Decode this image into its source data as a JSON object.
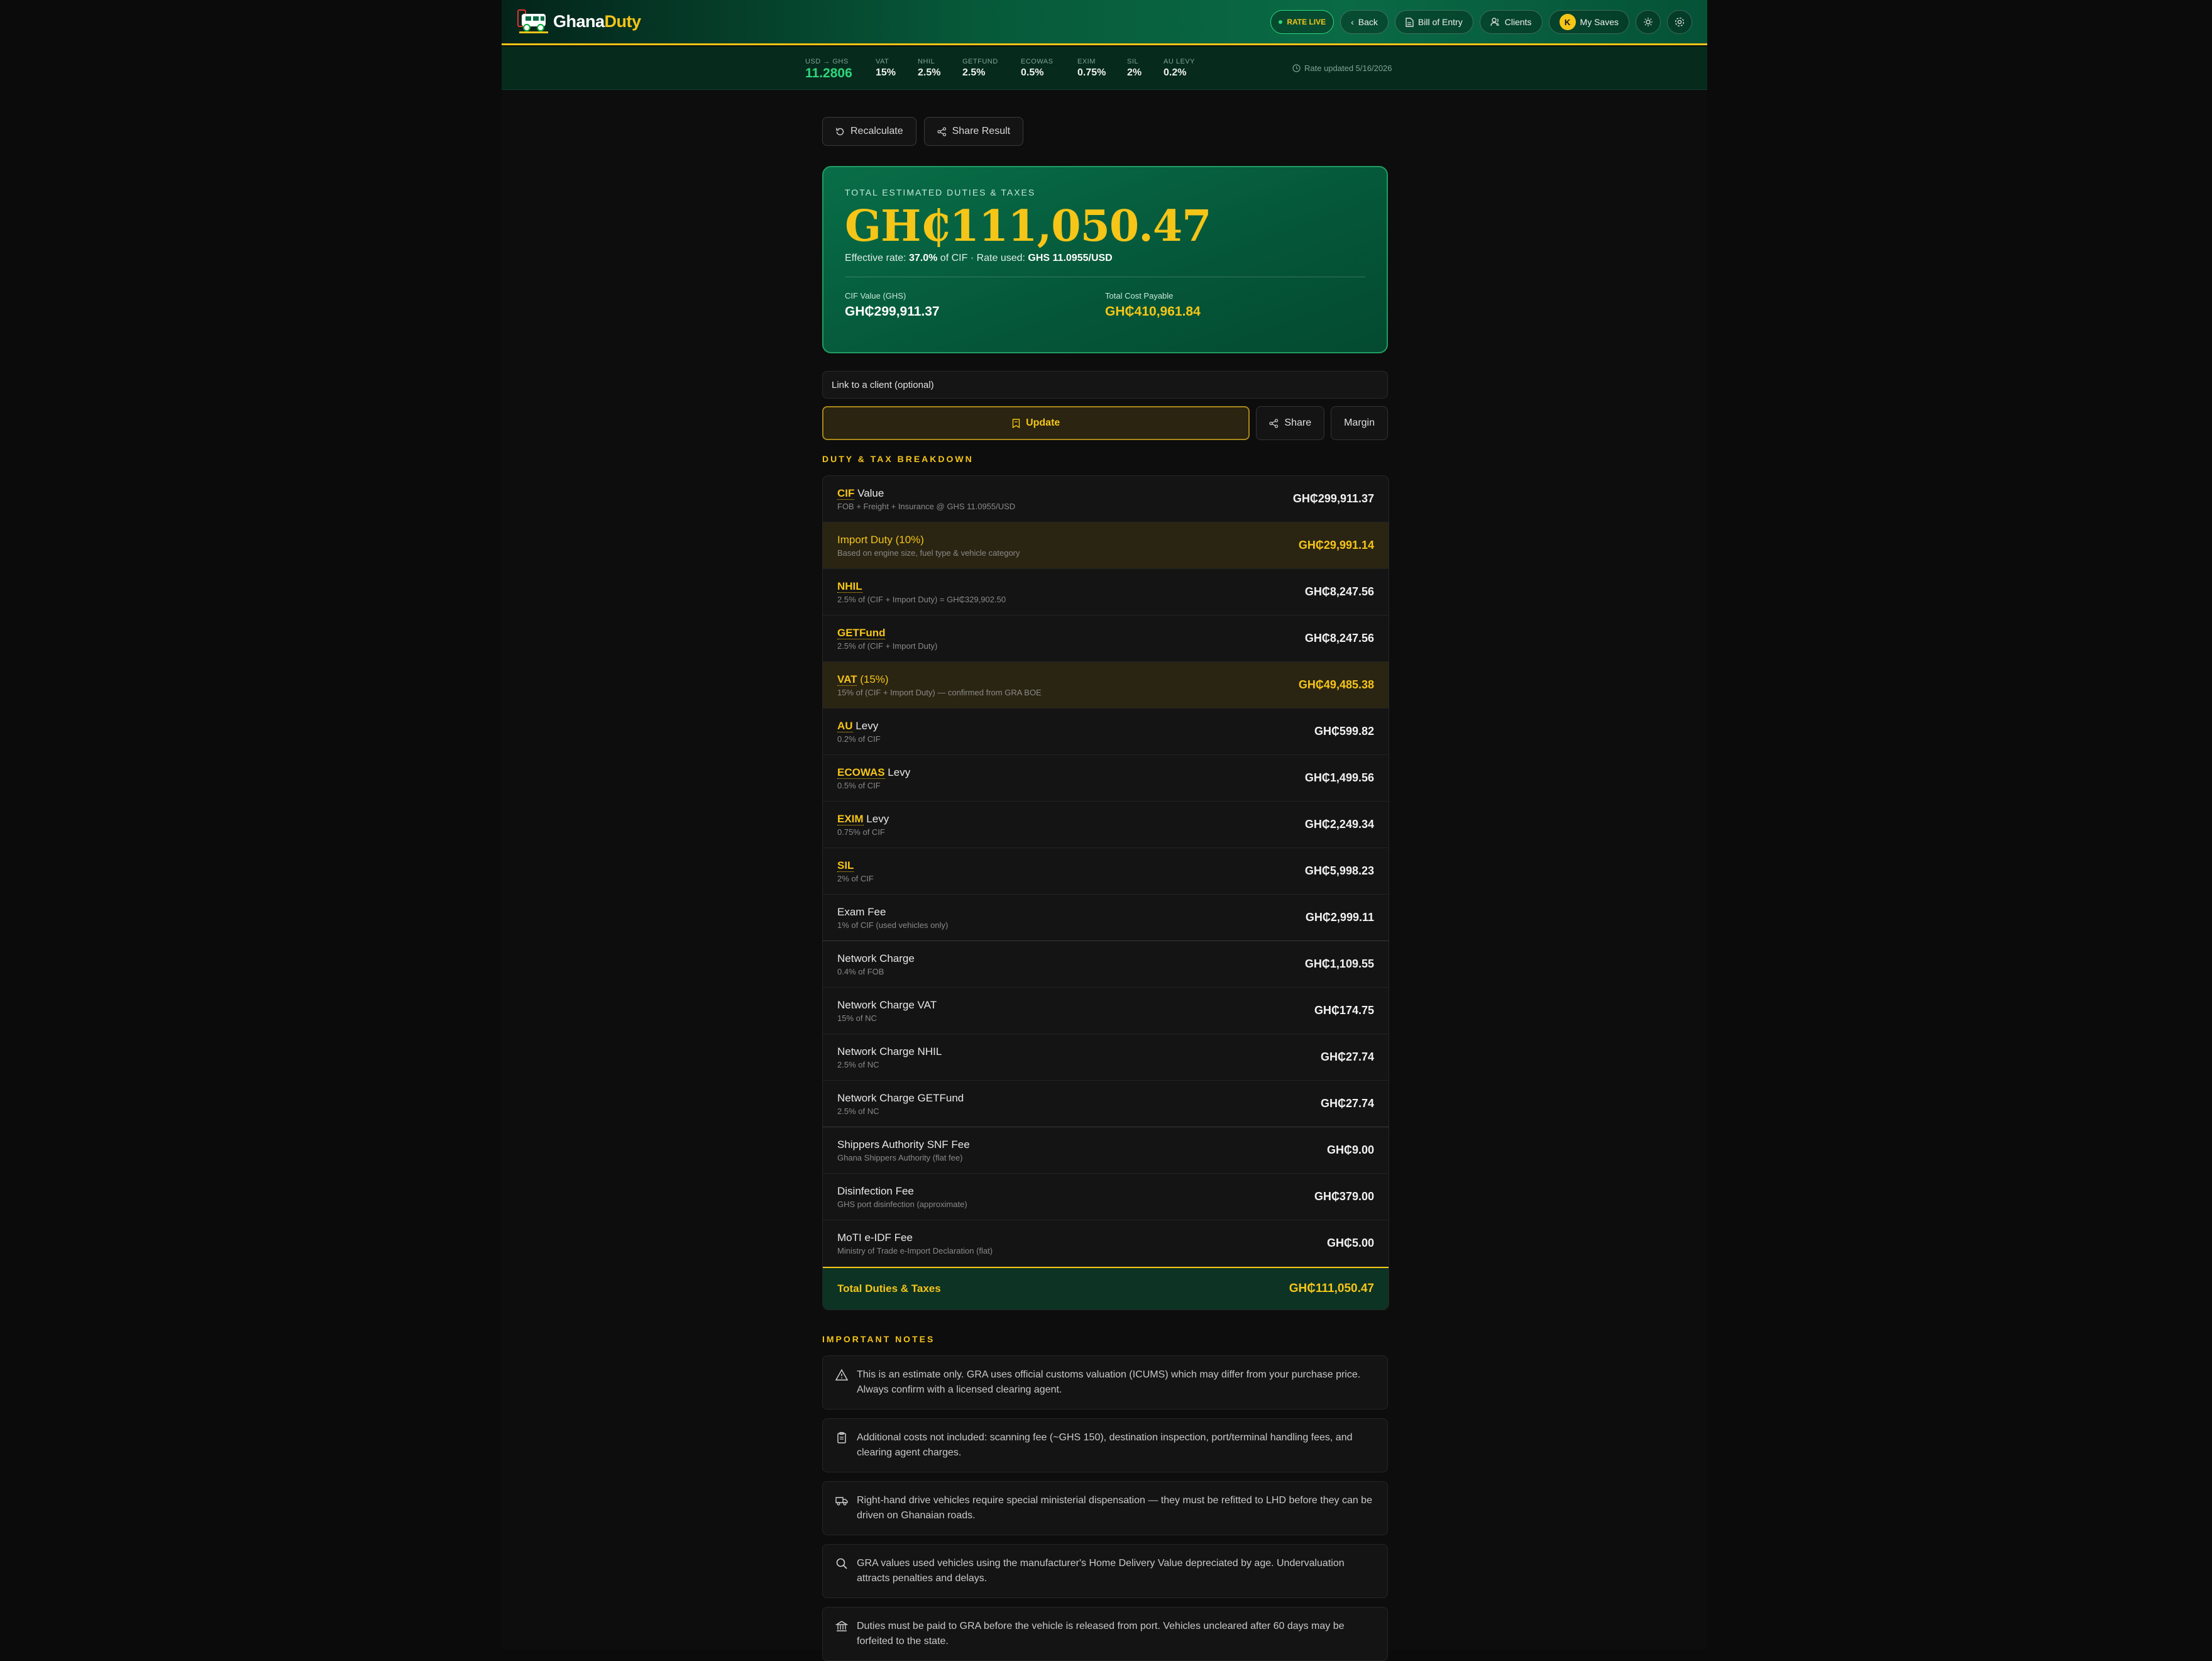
{
  "header": {
    "logo_text_1": "Ghana",
    "logo_text_2": "Duty",
    "rate_live": "RATE LIVE",
    "back": "Back",
    "bill_of_entry": "Bill of Entry",
    "clients": "Clients",
    "avatar_letter": "K",
    "my_saves": "My Saves"
  },
  "rates": {
    "usd_label": "USD → GHS",
    "usd_value": "11.2806",
    "items": [
      {
        "label": "VAT",
        "value": "15%"
      },
      {
        "label": "NHIL",
        "value": "2.5%"
      },
      {
        "label": "GETFUND",
        "value": "2.5%"
      },
      {
        "label": "ECOWAS",
        "value": "0.5%"
      },
      {
        "label": "EXIM",
        "value": "0.75%"
      },
      {
        "label": "SIL",
        "value": "2%"
      },
      {
        "label": "AU LEVY",
        "value": "0.2%"
      }
    ],
    "updated": "Rate updated 5/16/2026"
  },
  "actions": {
    "recalculate": "Recalculate",
    "share_result": "Share Result"
  },
  "hero": {
    "caption": "TOTAL ESTIMATED DUTIES & TAXES",
    "total": "GH₵111,050.47",
    "eff_prefix": "Effective rate: ",
    "eff_rate": "37.0%",
    "eff_mid": " of CIF · Rate used: ",
    "eff_used": "GHS 11.0955/USD",
    "cif_label": "CIF Value (GHS)",
    "cif_value": "GH₵299,911.37",
    "tcp_label": "Total Cost Payable",
    "tcp_value": "GH₵410,961.84"
  },
  "client_placeholder": "Link to a client (optional)",
  "buttons": {
    "update": "Update",
    "share": "Share",
    "margin": "Margin"
  },
  "breakdown_title": "DUTY & TAX BREAKDOWN",
  "rows": [
    {
      "abbr": "CIF",
      "label": " Value",
      "sub": "FOB + Freight + Insurance @ GHS 11.0955/USD",
      "amount": "GH₵299,911.37"
    },
    {
      "abbr": "",
      "label": "Import Duty (10%)",
      "sub": "Based on engine size, fuel type & vehicle category",
      "amount": "GH₵29,991.14"
    },
    {
      "abbr": "NHIL",
      "label": "",
      "sub": "2.5% of (CIF + Import Duty) = GH₵329,902.50",
      "amount": "GH₵8,247.56"
    },
    {
      "abbr": "GETFund",
      "label": "",
      "sub": "2.5% of (CIF + Import Duty)",
      "amount": "GH₵8,247.56"
    },
    {
      "abbr": "VAT",
      "label": " (15%)",
      "sub": "15% of (CIF + Import Duty) — confirmed from GRA BOE",
      "amount": "GH₵49,485.38"
    },
    {
      "abbr": "AU",
      "label": " Levy",
      "sub": "0.2% of CIF",
      "amount": "GH₵599.82"
    },
    {
      "abbr": "ECOWAS",
      "label": " Levy",
      "sub": "0.5% of CIF",
      "amount": "GH₵1,499.56"
    },
    {
      "abbr": "EXIM",
      "label": " Levy",
      "sub": "0.75% of CIF",
      "amount": "GH₵2,249.34"
    },
    {
      "abbr": "SIL",
      "label": "",
      "sub": "2% of CIF",
      "amount": "GH₵5,998.23"
    },
    {
      "abbr": "",
      "label": "Exam Fee",
      "sub": "1% of CIF (used vehicles only)",
      "amount": "GH₵2,999.11"
    },
    {
      "abbr": "",
      "label": "Network Charge",
      "sub": "0.4% of FOB",
      "amount": "GH₵1,109.55"
    },
    {
      "abbr": "",
      "label": "Network Charge VAT",
      "sub": "15% of NC",
      "amount": "GH₵174.75"
    },
    {
      "abbr": "",
      "label": "Network Charge NHIL",
      "sub": "2.5% of NC",
      "amount": "GH₵27.74"
    },
    {
      "abbr": "",
      "label": "Network Charge GETFund",
      "sub": "2.5% of NC",
      "amount": "GH₵27.74"
    },
    {
      "abbr": "",
      "label": "Shippers Authority SNF Fee",
      "sub": "Ghana Shippers Authority (flat fee)",
      "amount": "GH₵9.00"
    },
    {
      "abbr": "",
      "label": "Disinfection Fee",
      "sub": "GHS port disinfection (approximate)",
      "amount": "GH₵379.00"
    },
    {
      "abbr": "",
      "label": "MoTI e-IDF Fee",
      "sub": "Ministry of Trade e-Import Declaration (flat)",
      "amount": "GH₵5.00"
    }
  ],
  "total_row": {
    "label": "Total Duties & Taxes",
    "amount": "GH₵111,050.47"
  },
  "notes_title": "IMPORTANT NOTES",
  "notes": [
    {
      "icon": "warning-icon",
      "text": "This is an estimate only. GRA uses official customs valuation (ICUMS) which may differ from your purchase price. Always confirm with a licensed clearing agent."
    },
    {
      "icon": "clipboard-icon",
      "text": "Additional costs not included: scanning fee (~GHS 150), destination inspection, port/terminal handling fees, and clearing agent charges."
    },
    {
      "icon": "truck-icon",
      "text": "Right-hand drive vehicles require special ministerial dispensation — they must be refitted to LHD before they can be driven on Ghanaian roads."
    },
    {
      "icon": "search-icon",
      "text": "GRA values used vehicles using the manufacturer's Home Delivery Value depreciated by age. Undervaluation attracts penalties and delays."
    },
    {
      "icon": "bank-icon",
      "text": "Duties must be paid to GRA before the vehicle is released from port. Vehicles uncleared after 60 days may be forfeited to the state."
    }
  ],
  "colors": {
    "accent": "#f5c518",
    "brand_green": "#065a3a",
    "live_green": "#2fd67b"
  }
}
